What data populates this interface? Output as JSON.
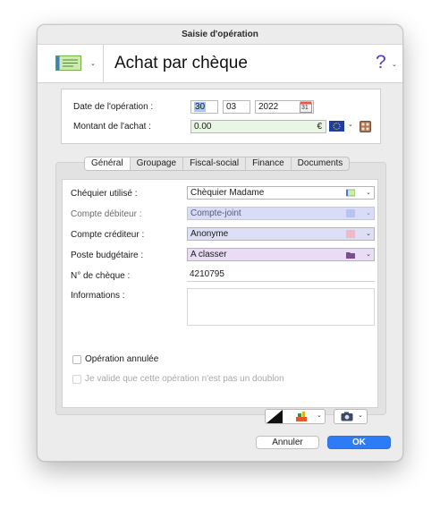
{
  "window": {
    "title": "Saisie d'opération"
  },
  "header": {
    "type_icon": "cheque-icon",
    "title": "Achat par chèque",
    "help_label": "?"
  },
  "top_form": {
    "date_label": "Date de l'opération :",
    "date_day": "30",
    "date_month": "03",
    "date_year": "2022",
    "calendar_icon_text": "31",
    "amount_label": "Montant de l'achat :",
    "amount_value": "0.00",
    "currency_symbol": "€",
    "currency_flag": "eu-flag-icon"
  },
  "tabs": [
    {
      "label": "Général",
      "active": true
    },
    {
      "label": "Groupage",
      "active": false
    },
    {
      "label": "Fiscal-social",
      "active": false
    },
    {
      "label": "Finance",
      "active": false
    },
    {
      "label": "Documents",
      "active": false
    }
  ],
  "general": {
    "checkbook_label": "Chéquier utilisé :",
    "checkbook_value": "Chèquier Madame",
    "debit_label": "Compte débiteur :",
    "debit_value": "Compte-joint",
    "credit_label": "Compte créditeur :",
    "credit_value": "Anonyme",
    "budget_label": "Poste budgétaire :",
    "budget_value": "A classer",
    "cheque_no_label": "N° de chèque :",
    "cheque_no_value": "4210795",
    "info_label": "Informations :",
    "info_value": "",
    "cancelled_label": "Opération annulée",
    "duplicate_label": "Je valide que cette opération n'est pas un doublon"
  },
  "colors": {
    "debit_bg": "#d8dcf6",
    "credit_bg": "#dcdff5",
    "budget_bg": "#e9ddf5",
    "amount_bg": "#eaf6e4",
    "ok_blue": "#2d7cf6"
  },
  "footer": {
    "cancel_label": "Annuler",
    "ok_label": "OK"
  }
}
